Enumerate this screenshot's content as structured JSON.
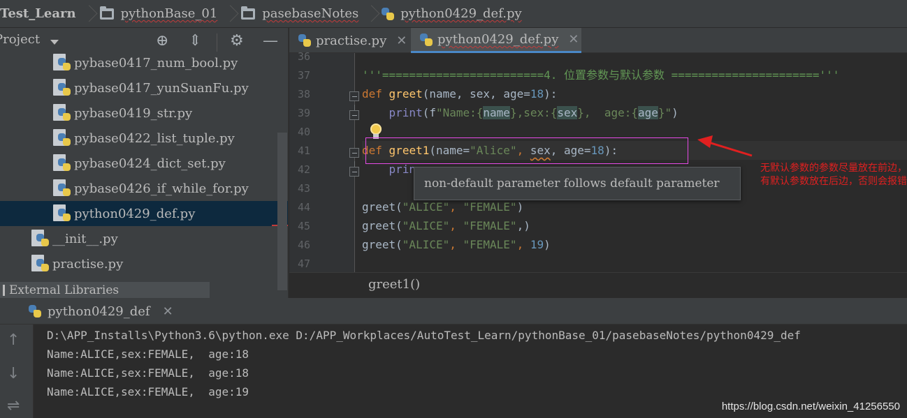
{
  "breadcrumb": {
    "items": [
      "Test_Learn",
      "pythonBase_01",
      "pasebaseNotes",
      "python0429_def.py"
    ]
  },
  "project": {
    "title": "Project",
    "files": [
      "pybase0417_num_bool.py",
      "pybase0417_yunSuanFu.py",
      "pybase0419_str.py",
      "pybase0422_list_tuple.py",
      "pybase0424_dict_set.py",
      "pybase0426_if_while_for.py",
      "python0429_def.py",
      "__init__.py",
      "practise.py"
    ],
    "external_libraries": "External Libraries"
  },
  "editor": {
    "tabs": [
      "practise.py",
      "python0429_def.py"
    ],
    "line_numbers": [
      "36",
      "37",
      "38",
      "39",
      "40",
      "41",
      "42",
      "43",
      "44",
      "45",
      "46",
      "47"
    ],
    "code": {
      "l37": "'''========================4. 位置参数与默认参数 ======================'''",
      "l38_kw": "def",
      "l38_fn": "greet",
      "l38_a": "(name, sex, age=",
      "l38_n": "18",
      "l38_b": "):",
      "l39_bi": "print",
      "l39_a": "(f",
      "l39_s1": "\"Name:{",
      "l39_v1": "name",
      "l39_s2": "},sex:{",
      "l39_v2": "sex",
      "l39_s3": "},  age:{",
      "l39_v3": "age",
      "l39_s4": "}\"",
      "l39_b": ")",
      "l41_kw": "def",
      "l41_fn": "greet1",
      "l41_a": "(name=",
      "l41_s": "\"Alice\"",
      "l41_c": ", ",
      "l41_w": "sex",
      "l41_d": ", age=",
      "l41_n": "18",
      "l41_b": "):",
      "l42_bi": "prin",
      "l44_a": "greet(",
      "l44_s1": "\"ALICE\"",
      "l44_c": ", ",
      "l44_s2": "\"FEMALE\"",
      "l44_b": ")",
      "l45_a": "greet(",
      "l45_s1": "\"ALICE\"",
      "l45_c": ", ",
      "l45_s2": "\"FEMALE\"",
      "l45_b": ",)",
      "l46_a": "greet(",
      "l46_s1": "\"ALICE\"",
      "l46_c": ", ",
      "l46_s2": "\"FEMALE\"",
      "l46_d": ", ",
      "l46_n": "19",
      "l46_b": ")"
    },
    "tooltip": "non-default parameter follows default parameter",
    "breadcrumb": "greet1()"
  },
  "annotation": {
    "text": "无默认参数的参数尽量放在前边，有默认参数放在后边，否则会报错",
    "color": "#e02020"
  },
  "run": {
    "tab": "python0429_def",
    "output": [
      "D:\\APP_Installs\\Python3.6\\python.exe D:/APP_Workplaces/AutoTest_Learn/pythonBase_01/pasebaseNotes/python0429_def",
      "Name:ALICE,sex:FEMALE,  age:18",
      "Name:ALICE,sex:FEMALE,  age:18",
      "Name:ALICE,sex:FEMALE,  age:19"
    ]
  },
  "watermark": "https://blog.csdn.net/weixin_41256550",
  "colors": {
    "keyword": "#cc7832",
    "function": "#ffc66d",
    "string": "#6a8759",
    "number": "#6897bb",
    "selection": "#0d293e",
    "box": "#e64ae6"
  }
}
